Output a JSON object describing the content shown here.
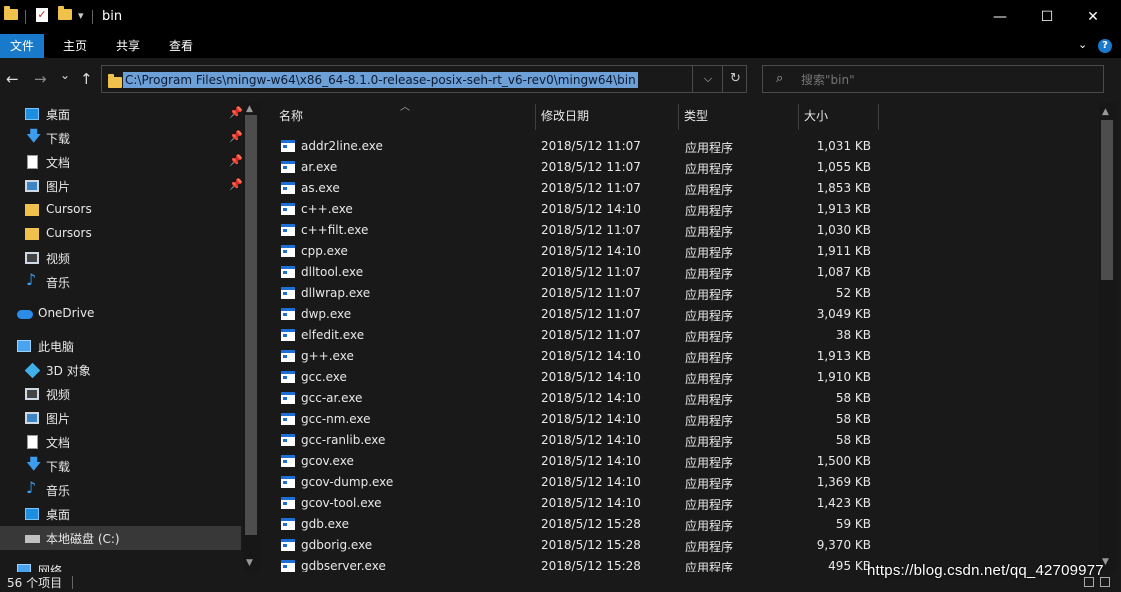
{
  "window": {
    "title": "bin",
    "minimize_icon": "—",
    "maximize_icon": "☐",
    "close_icon": "✕",
    "qat_dropdown": "▾"
  },
  "ribbon": {
    "tabs": [
      "文件",
      "主页",
      "共享",
      "查看"
    ],
    "collapse_icon": "chevron-down-icon",
    "help_label": "?"
  },
  "nav": {
    "back_icon": "←",
    "forward_icon": "→",
    "recent_icon": "⌄",
    "up_icon": "↑",
    "address": "C:\\Program Files\\mingw-w64\\x86_64-8.1.0-release-posix-seh-rt_v6-rev0\\mingw64\\bin",
    "address_dropdown": "⌵",
    "refresh_icon": "↻",
    "search_placeholder": "搜索\"bin\""
  },
  "sidebar": {
    "items": [
      {
        "label": "桌面",
        "icon": "desktop-icon",
        "pinned": true
      },
      {
        "label": "下载",
        "icon": "download-icon",
        "pinned": true
      },
      {
        "label": "文档",
        "icon": "document-icon",
        "pinned": true
      },
      {
        "label": "图片",
        "icon": "pictures-icon",
        "pinned": true
      },
      {
        "label": "Cursors",
        "icon": "folder-icon",
        "pinned": false
      },
      {
        "label": "Cursors",
        "icon": "folder-icon",
        "pinned": false
      },
      {
        "label": "视频",
        "icon": "video-icon",
        "pinned": false
      },
      {
        "label": "音乐",
        "icon": "music-icon",
        "pinned": false
      },
      {
        "label": "OneDrive",
        "icon": "onedrive-icon",
        "pinned": false
      },
      {
        "label": "此电脑",
        "icon": "this-pc-icon",
        "pinned": false
      },
      {
        "label": "3D 对象",
        "icon": "3d-objects-icon",
        "pinned": false
      },
      {
        "label": "视频",
        "icon": "video-icon",
        "pinned": false
      },
      {
        "label": "图片",
        "icon": "pictures-icon",
        "pinned": false
      },
      {
        "label": "文档",
        "icon": "document-icon",
        "pinned": false
      },
      {
        "label": "下载",
        "icon": "download-icon",
        "pinned": false
      },
      {
        "label": "音乐",
        "icon": "music-icon",
        "pinned": false
      },
      {
        "label": "桌面",
        "icon": "desktop-icon",
        "pinned": false
      },
      {
        "label": "本地磁盘 (C:)",
        "icon": "local-disk-icon",
        "pinned": false,
        "selected": true
      },
      {
        "label": "网络",
        "icon": "network-icon",
        "pinned": false
      }
    ]
  },
  "columns": {
    "name": "名称",
    "date": "修改日期",
    "type": "类型",
    "size": "大小"
  },
  "files": [
    {
      "name": "addr2line.exe",
      "date": "2018/5/12 11:07",
      "type": "应用程序",
      "size": "1,031 KB"
    },
    {
      "name": "ar.exe",
      "date": "2018/5/12 11:07",
      "type": "应用程序",
      "size": "1,055 KB"
    },
    {
      "name": "as.exe",
      "date": "2018/5/12 11:07",
      "type": "应用程序",
      "size": "1,853 KB"
    },
    {
      "name": "c++.exe",
      "date": "2018/5/12 14:10",
      "type": "应用程序",
      "size": "1,913 KB"
    },
    {
      "name": "c++filt.exe",
      "date": "2018/5/12 11:07",
      "type": "应用程序",
      "size": "1,030 KB"
    },
    {
      "name": "cpp.exe",
      "date": "2018/5/12 14:10",
      "type": "应用程序",
      "size": "1,911 KB"
    },
    {
      "name": "dlltool.exe",
      "date": "2018/5/12 11:07",
      "type": "应用程序",
      "size": "1,087 KB"
    },
    {
      "name": "dllwrap.exe",
      "date": "2018/5/12 11:07",
      "type": "应用程序",
      "size": "52 KB"
    },
    {
      "name": "dwp.exe",
      "date": "2018/5/12 11:07",
      "type": "应用程序",
      "size": "3,049 KB"
    },
    {
      "name": "elfedit.exe",
      "date": "2018/5/12 11:07",
      "type": "应用程序",
      "size": "38 KB"
    },
    {
      "name": "g++.exe",
      "date": "2018/5/12 14:10",
      "type": "应用程序",
      "size": "1,913 KB"
    },
    {
      "name": "gcc.exe",
      "date": "2018/5/12 14:10",
      "type": "应用程序",
      "size": "1,910 KB"
    },
    {
      "name": "gcc-ar.exe",
      "date": "2018/5/12 14:10",
      "type": "应用程序",
      "size": "58 KB"
    },
    {
      "name": "gcc-nm.exe",
      "date": "2018/5/12 14:10",
      "type": "应用程序",
      "size": "58 KB"
    },
    {
      "name": "gcc-ranlib.exe",
      "date": "2018/5/12 14:10",
      "type": "应用程序",
      "size": "58 KB"
    },
    {
      "name": "gcov.exe",
      "date": "2018/5/12 14:10",
      "type": "应用程序",
      "size": "1,500 KB"
    },
    {
      "name": "gcov-dump.exe",
      "date": "2018/5/12 14:10",
      "type": "应用程序",
      "size": "1,369 KB"
    },
    {
      "name": "gcov-tool.exe",
      "date": "2018/5/12 14:10",
      "type": "应用程序",
      "size": "1,423 KB"
    },
    {
      "name": "gdb.exe",
      "date": "2018/5/12 15:28",
      "type": "应用程序",
      "size": "59 KB"
    },
    {
      "name": "gdborig.exe",
      "date": "2018/5/12 15:28",
      "type": "应用程序",
      "size": "9,370 KB"
    },
    {
      "name": "gdbserver.exe",
      "date": "2018/5/12 15:28",
      "type": "应用程序",
      "size": "495 KB"
    }
  ],
  "status": {
    "item_count": "56 个项目"
  },
  "watermark": "https://blog.csdn.net/qq_42709977",
  "colors": {
    "accent": "#1979ca",
    "background": "#191919",
    "selection": "#6ea0d8"
  }
}
